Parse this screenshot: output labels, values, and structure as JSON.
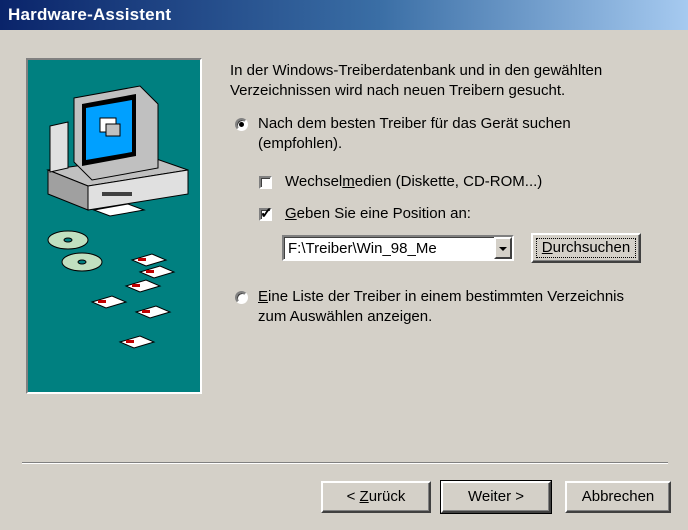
{
  "window": {
    "title": "Hardware-Assistent"
  },
  "intro_text": "In der Windows-Treiberdatenbank und in den gewählten Verzeichnissen wird nach neuen Treibern gesucht.",
  "option_search": {
    "label_line1": "Nach dem besten Treiber für das Gerät suchen",
    "label_line2": "(empfohlen).",
    "selected": true
  },
  "check_removable": {
    "pre": "Wechsel",
    "accel": "m",
    "post": "edien (Diskette, CD-ROM...)",
    "checked": false
  },
  "check_location": {
    "accel": "G",
    "post": "eben Sie eine Position an:",
    "checked": true
  },
  "location_combo": {
    "value": "F:\\Treiber\\Win_98_Me"
  },
  "browse_button": {
    "accel": "D",
    "post": "urchsuchen"
  },
  "option_list": {
    "accel": "E",
    "label_line1_post": "ine Liste der Treiber in einem bestimmten Verzeichnis",
    "label_line2": "zum Auswählen anzeigen.",
    "selected": false
  },
  "buttons": {
    "back": {
      "pre": "< ",
      "accel": "Z",
      "post": "urück"
    },
    "next": "Weiter >",
    "cancel": "Abbrechen"
  }
}
